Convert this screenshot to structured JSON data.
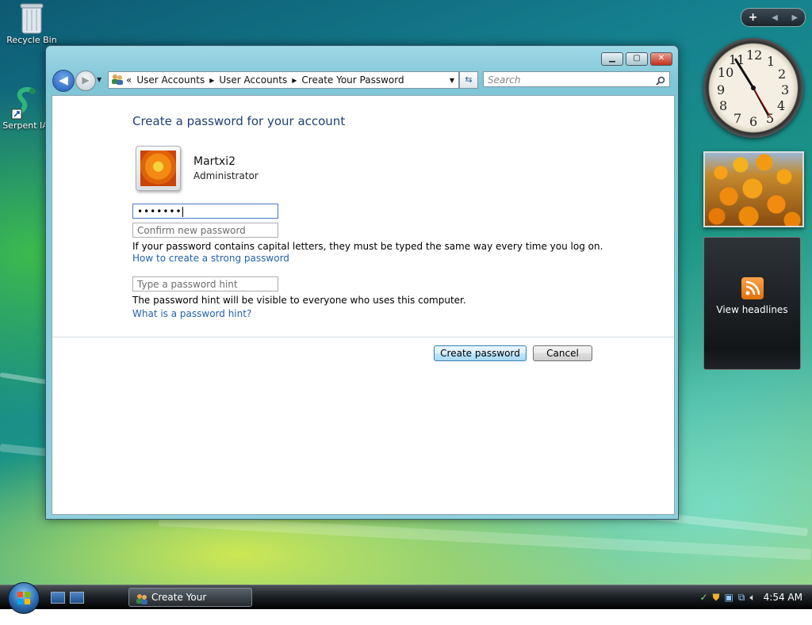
{
  "desktop": {
    "icons": [
      {
        "label": "Recycle Bin"
      },
      {
        "label": "Serpent IA"
      }
    ]
  },
  "gadgets": {
    "clock_numbers": [
      "12",
      "1",
      "2",
      "3",
      "4",
      "5",
      "6",
      "7",
      "8",
      "9",
      "10",
      "11"
    ],
    "feed_label": "View headlines"
  },
  "window": {
    "address": {
      "overflow": "«",
      "crumbs": [
        "User Accounts",
        "User Accounts",
        "Create Your Password"
      ]
    },
    "search_placeholder": "Search",
    "heading": "Create a password for your account",
    "user": {
      "name": "Martxi2",
      "role": "Administrator"
    },
    "password_value": "•••••••",
    "confirm_placeholder": "Confirm new password",
    "caps_note": "If your password contains capital letters, they must be typed the same way every time you log on.",
    "strong_link": "How to create a strong password",
    "hint_placeholder": "Type a password hint",
    "hint_note": "The password hint will be visible to everyone who uses this computer.",
    "hint_link": "What is a password hint?",
    "create_button": "Create password",
    "cancel_button": "Cancel"
  },
  "taskbar": {
    "task_label": "Create Your Password",
    "time": "4:54 AM"
  }
}
